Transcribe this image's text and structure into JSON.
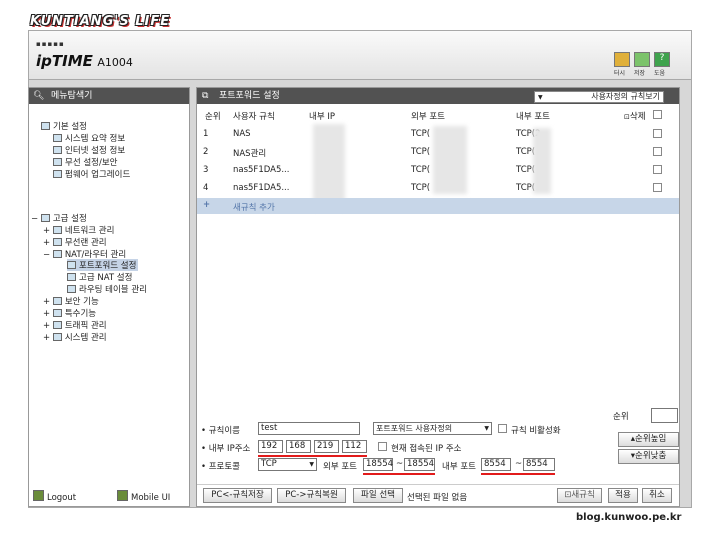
{
  "blog_title": "KUNTIANG'S LIFE",
  "header": {
    "dots": "▪▪▪▪▪",
    "brand": "ipTIME",
    "model": "A1004",
    "buttons": [
      {
        "label": "터시",
        "color": "#e0b03a"
      },
      {
        "label": "저장",
        "color": "#7cc36b"
      },
      {
        "label": "도움",
        "color": "#3fa34d"
      }
    ]
  },
  "sidebar": {
    "title": "메뉴탐색기",
    "basic": "기본 설정",
    "basic_items": [
      "시스템 요약 정보",
      "인터넷 설정 정보",
      "무선 설정/보안",
      "펌웨어 업그레이드"
    ],
    "advanced": "고급 설정",
    "network": "네트워크 관리",
    "wireless": "무선랜 관리",
    "nat": "NAT/라우터 관리",
    "nat_items": [
      "포트포워드 설정",
      "고급 NAT 설정",
      "라우팅 테이블 관리"
    ],
    "others": [
      "보안 기능",
      "특수기능",
      "트래픽 관리",
      "시스템 관리"
    ],
    "logout": "Logout",
    "mobile": "Mobile UI"
  },
  "main": {
    "title": "포트포워드 설정",
    "view_select": "사용자정의 규칙보기",
    "columns": {
      "no": "순위",
      "rule": "사용자 규칙",
      "ip": "내부 IP",
      "ext": "외부 포트",
      "int": "내부 포트",
      "del": "삭제"
    },
    "rows": [
      {
        "no": "1",
        "rule": "NAS",
        "ext": "TCP(",
        "int": "TCP(2"
      },
      {
        "no": "2",
        "rule": "NAS관리",
        "ext": "TCP(",
        "int": "TCP("
      },
      {
        "no": "3",
        "rule": "nas5F1DA5...",
        "ext": "TCP(",
        "int": "TCP("
      },
      {
        "no": "4",
        "rule": "nas5F1DA5...",
        "ext": "TCP(",
        "int": "TCP("
      }
    ],
    "add_rule": "새규칙 추가"
  },
  "form": {
    "rule_name_label": "규칙이름",
    "rule_name": "test",
    "type_select": "포트포워드 사용자정의",
    "disable_label": "규칙 비활성화",
    "ip_label": "내부 IP주소",
    "ip": [
      "192",
      "168",
      "219",
      "112"
    ],
    "current_ip_label": "현재 접속된 IP 주소",
    "proto_label": "프로토콜",
    "proto": "TCP",
    "ext_port_label": "외부 포트",
    "ext_from": "18554",
    "ext_to": "18554",
    "int_port_label": "내부 포트",
    "int_from": "8554",
    "int_to": "8554",
    "tilde": "~",
    "rank_label": "순위",
    "rank_up": "순위높임",
    "rank_down": "순위낮춤"
  },
  "bottom": {
    "pc_save": "PC<-규칙저장",
    "pc_restore": "PC->규칙복원",
    "file_select": "파일 선택",
    "file_none": "선택된 파일 없음",
    "new_rule": "새규칙",
    "apply": "적용",
    "cancel": "취소"
  },
  "watermark": "blog.kunwoo.pe.kr"
}
